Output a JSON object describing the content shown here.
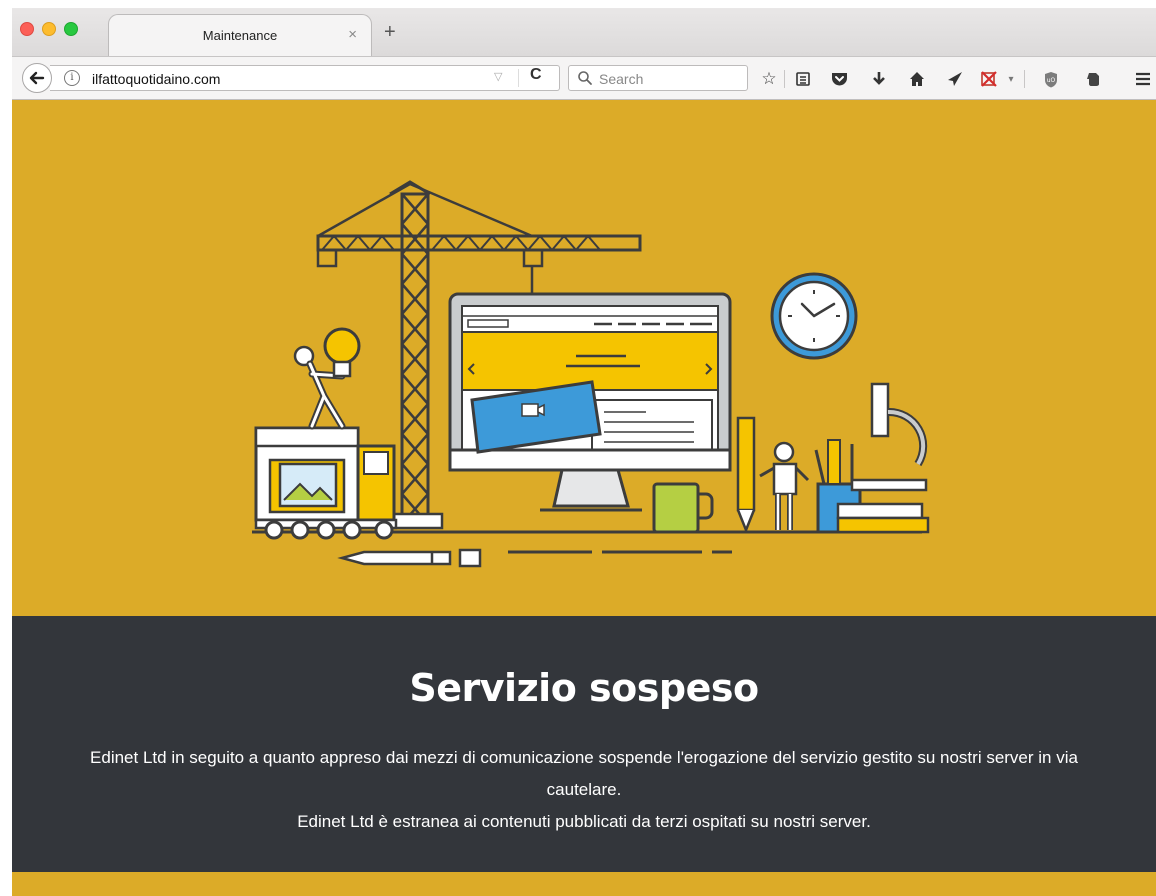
{
  "browser": {
    "tab_title": "Maintenance",
    "tab_close": "×",
    "new_tab": "+",
    "url": "ilfattoquotidaino.com",
    "search_placeholder": "Search",
    "toolbar_icons": [
      "back-arrow-icon",
      "info-icon",
      "url-dropdown-icon",
      "reload-icon",
      "search-icon",
      "bookmark-star-icon",
      "reading-list-icon",
      "pocket-icon",
      "downloads-icon",
      "home-icon",
      "send-icon",
      "blocked-extension-icon",
      "extension-dropdown-icon",
      "ublock-icon",
      "evernote-icon",
      "menu-hamburger-icon"
    ]
  },
  "page": {
    "heading": "Servizio sospeso",
    "paragraph_1": "Edinet Ltd in seguito a quanto appreso dai mezzi di comunicazione sospende l'erogazione del servizio gestito su nostri server in via cautelare.",
    "paragraph_2": "Edinet Ltd è estranea ai contenuti pubblicati da terzi ospitati su nostri server."
  },
  "colors": {
    "hero_bg": "#dcab28",
    "dark_bg": "#33363b",
    "illustration_yellow": "#f5c400",
    "illustration_blue": "#3d9ad9",
    "illustration_green": "#b5cf43",
    "line_dark": "#3c3c3c"
  }
}
